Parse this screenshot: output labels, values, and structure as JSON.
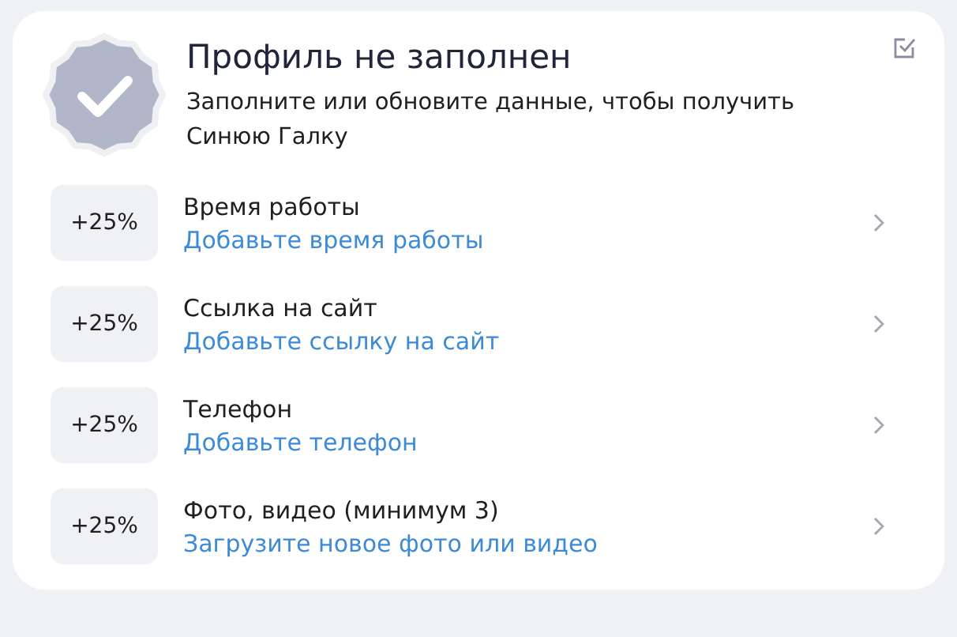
{
  "header": {
    "title": "Профиль не заполнен",
    "subtitle": "Заполните или обновите данные, чтобы получить Синюю Галку"
  },
  "items": [
    {
      "bonus": "+25%",
      "title": "Время работы",
      "action": "Добавьте время работы"
    },
    {
      "bonus": "+25%",
      "title": "Ссылка на сайт",
      "action": "Добавьте ссылку на сайт"
    },
    {
      "bonus": "+25%",
      "title": "Телефон",
      "action": "Добавьте телефон"
    },
    {
      "bonus": "+25%",
      "title": "Фото, видео (минимум 3)",
      "action": "Загрузите новое фото или видео"
    }
  ]
}
